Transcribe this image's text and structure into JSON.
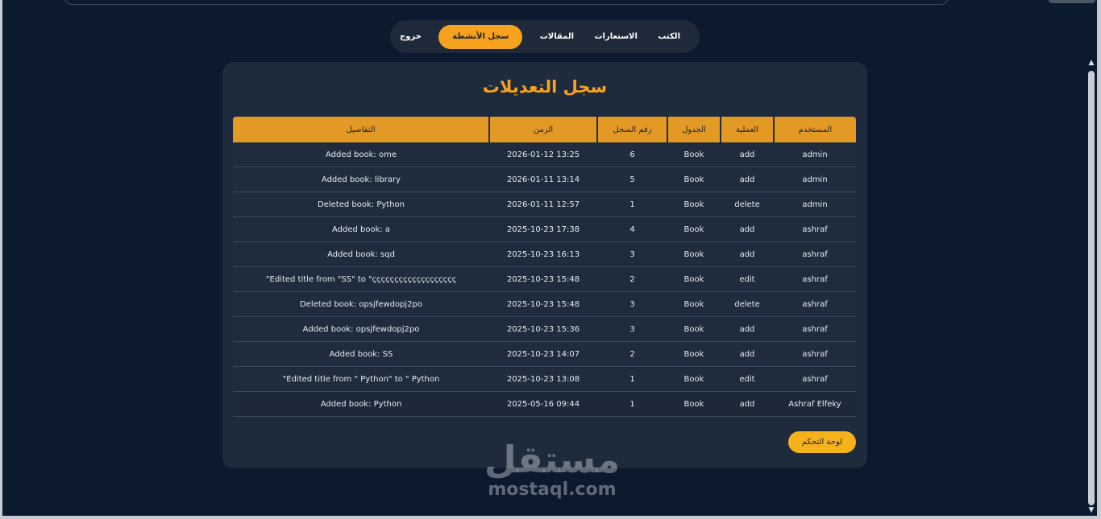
{
  "nav": {
    "items": [
      {
        "label": "الكتب",
        "active": false
      },
      {
        "label": "الاستعارات",
        "active": false
      },
      {
        "label": "المقالات",
        "active": false
      },
      {
        "label": "سجل الأنشطة",
        "active": true
      },
      {
        "label": "خروج",
        "active": false
      }
    ]
  },
  "page": {
    "title": "سجل التعديلات"
  },
  "table": {
    "headers": {
      "user": "المستخدم",
      "action": "العملية",
      "table": "الجدول",
      "record_id": "رقم السجل",
      "time": "الزمن",
      "details": "التفاصيل"
    },
    "rows": [
      {
        "user": "admin",
        "action": "add",
        "table": "Book",
        "record_id": "6",
        "time": "2026-01-12 13:25",
        "details": "Added book: ome"
      },
      {
        "user": "admin",
        "action": "add",
        "table": "Book",
        "record_id": "5",
        "time": "2026-01-11 13:14",
        "details": "Added book: library"
      },
      {
        "user": "admin",
        "action": "delete",
        "table": "Book",
        "record_id": "1",
        "time": "2026-01-11 12:57",
        "details": "Deleted book: Python"
      },
      {
        "user": "ashraf",
        "action": "add",
        "table": "Book",
        "record_id": "4",
        "time": "2025-10-23 17:38",
        "details": "Added book: a"
      },
      {
        "user": "ashraf",
        "action": "add",
        "table": "Book",
        "record_id": "3",
        "time": "2025-10-23 16:13",
        "details": "Added book: sqd"
      },
      {
        "user": "ashraf",
        "action": "edit",
        "table": "Book",
        "record_id": "2",
        "time": "2025-10-23 15:48",
        "details": "Edited title from \"SS\" to \"ççççççççççççççççççç\""
      },
      {
        "user": "ashraf",
        "action": "delete",
        "table": "Book",
        "record_id": "3",
        "time": "2025-10-23 15:48",
        "details": "Deleted book: opsjfewdopj2po"
      },
      {
        "user": "ashraf",
        "action": "add",
        "table": "Book",
        "record_id": "3",
        "time": "2025-10-23 15:36",
        "details": "Added book: opsjfewdopj2po"
      },
      {
        "user": "ashraf",
        "action": "add",
        "table": "Book",
        "record_id": "2",
        "time": "2025-10-23 14:07",
        "details": "Added book: SS"
      },
      {
        "user": "ashraf",
        "action": "edit",
        "table": "Book",
        "record_id": "1",
        "time": "2025-10-23 13:08",
        "details": "Edited title from \" Python\" to \" Python\""
      },
      {
        "user": "Ashraf Elfeky",
        "action": "add",
        "table": "Book",
        "record_id": "1",
        "time": "2025-05-16 09:44",
        "details": "Added book: Python",
        "highlighted": true
      }
    ]
  },
  "dashboard_button": {
    "label": "لوحة التحكم"
  },
  "watermark": {
    "arabic": "مستقل",
    "latin": "mostaql.com"
  },
  "colors": {
    "background": "#0b1a2e",
    "card": "#1e2b3c",
    "accent": "#f6a21e",
    "table_header": "#e29a25"
  }
}
